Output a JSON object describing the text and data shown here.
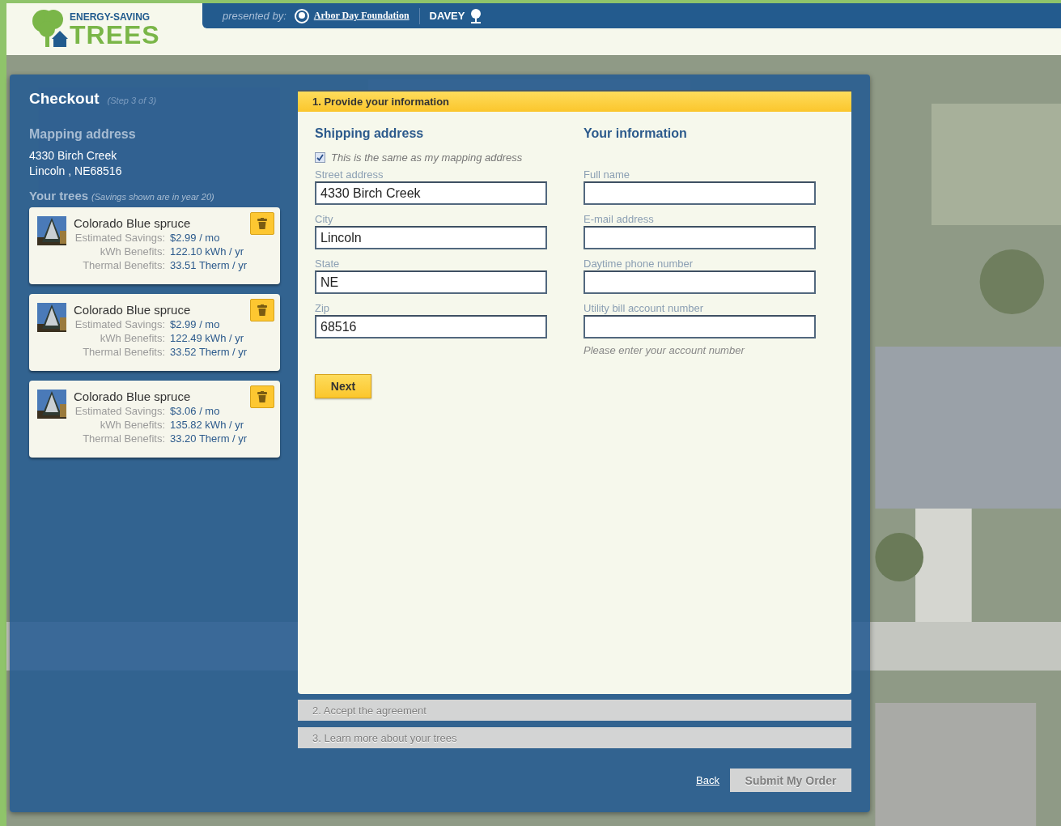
{
  "header": {
    "logo_top": "ENERGY-SAVING",
    "logo_main": "TREES",
    "presented_by": "presented by:",
    "sponsors": [
      "Arbor Day Foundation",
      "DAVEY"
    ]
  },
  "checkout": {
    "title": "Checkout",
    "step": "(Step 3 of 3)",
    "mapping_heading": "Mapping address",
    "mapping_lines": [
      "4330 Birch Creek",
      "Lincoln , NE68516"
    ],
    "trees_heading": "Your trees",
    "trees_note": "(Savings shown are in year 20)",
    "trees": [
      {
        "name": "Colorado Blue spruce",
        "rows": [
          {
            "label": "Estimated Savings:",
            "value": "$2.99 / mo"
          },
          {
            "label": "kWh Benefits:",
            "value": "122.10 kWh / yr"
          },
          {
            "label": "Thermal Benefits:",
            "value": "33.51 Therm / yr"
          }
        ]
      },
      {
        "name": "Colorado Blue spruce",
        "rows": [
          {
            "label": "Estimated Savings:",
            "value": "$2.99 / mo"
          },
          {
            "label": "kWh Benefits:",
            "value": "122.49 kWh / yr"
          },
          {
            "label": "Thermal Benefits:",
            "value": "33.52 Therm / yr"
          }
        ]
      },
      {
        "name": "Colorado Blue spruce",
        "rows": [
          {
            "label": "Estimated Savings:",
            "value": "$3.06 / mo"
          },
          {
            "label": "kWh Benefits:",
            "value": "135.82 kWh / yr"
          },
          {
            "label": "Thermal Benefits:",
            "value": "33.20 Therm / yr"
          }
        ]
      }
    ]
  },
  "steps": [
    {
      "title": "1. Provide your information",
      "selected": true
    },
    {
      "title": "2. Accept the agreement",
      "selected": false
    },
    {
      "title": "3. Learn more about your trees",
      "selected": false
    }
  ],
  "shipping": {
    "heading": "Shipping address",
    "same_as_mapping": {
      "label": "This is the same as my mapping address",
      "checked": true
    },
    "fields": [
      {
        "label": "Street address",
        "value": "4330 Birch Creek"
      },
      {
        "label": "City",
        "value": "Lincoln"
      },
      {
        "label": "State",
        "value": "NE"
      },
      {
        "label": "Zip",
        "value": "68516"
      }
    ]
  },
  "your_info": {
    "heading": "Your information",
    "fields": [
      {
        "label": "Full name"
      },
      {
        "label": "E-mail address"
      },
      {
        "label": "Daytime phone number"
      },
      {
        "label": "Utility bill account number"
      }
    ],
    "hint": "Please enter your account number"
  },
  "next_button": "Next",
  "back_link": "Back",
  "submit_button": {
    "label": "Submit My Order",
    "disabled": true
  }
}
